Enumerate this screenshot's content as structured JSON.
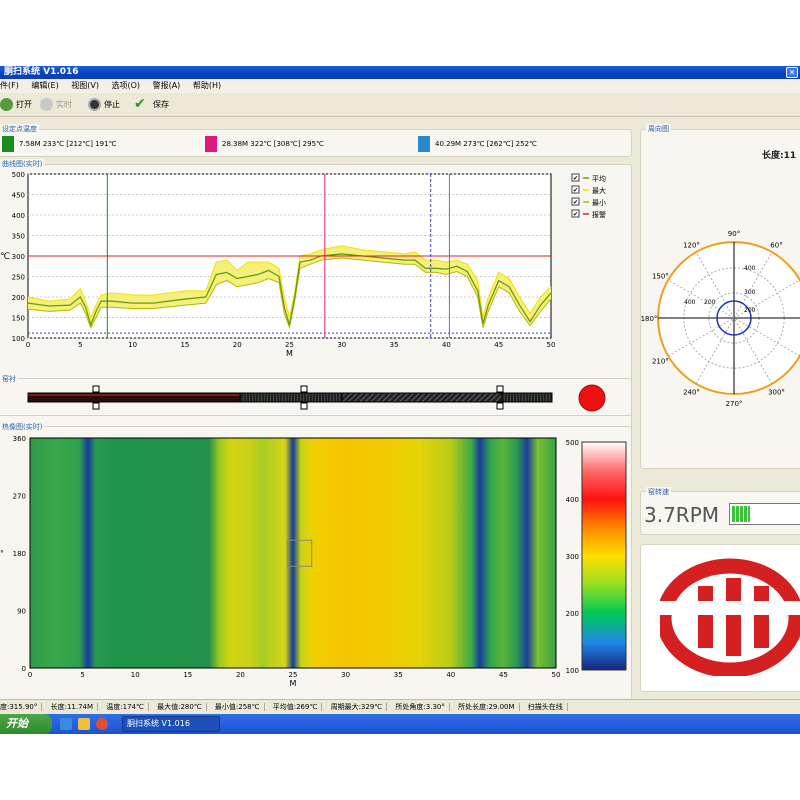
{
  "window": {
    "title": "胴扫系统 V1.016"
  },
  "menu": [
    "件(F)",
    "编辑(E)",
    "视图(V)",
    "选项(O)",
    "警报(A)",
    "帮助(H)"
  ],
  "toolbar": {
    "open": "打开",
    "realtime": "实时",
    "stop": "停止",
    "save": "保存"
  },
  "setpoints": {
    "title": "设定点温度",
    "items": [
      {
        "color": "#1a8a1a",
        "text": "7.58M 233℃ [212℃] 191℃"
      },
      {
        "color": "#e0197a",
        "text": "28.38M 322℃ [308℃] 295℃"
      },
      {
        "color": "#2a8ad0",
        "text": "40.29M 273℃ [262℃] 252℃"
      }
    ]
  },
  "curve": {
    "title": "曲线图(实时)",
    "ylabel": "℃",
    "xlabel": "M",
    "legend": [
      "平均",
      "最大",
      "最小",
      "报警"
    ],
    "alarm_line": 300
  },
  "kiln": {
    "title": "窑衬"
  },
  "thermal": {
    "title": "热像图(实时)",
    "xlabel": "M",
    "ylabel": "°"
  },
  "polar": {
    "title": "周向图",
    "length_label": "长度:11",
    "angle_labels": [
      "90°",
      "60°",
      "120°",
      "150°",
      "180°",
      "210°",
      "240°",
      "270°",
      "300°"
    ],
    "radial_labels": [
      "400",
      "300",
      "200",
      "400",
      "200"
    ]
  },
  "speed": {
    "title": "窑转速",
    "value": "3.7RPM"
  },
  "status": [
    "度:315.90°",
    "长度:11.74M",
    "温度:174℃",
    "最大值:280℃",
    "最小值:258℃",
    "平均值:269℃",
    "周期最大:329℃",
    "所处角度:3.30°",
    "所处长度:29.00M",
    "扫描头在线"
  ],
  "taskbar": {
    "start": "开始",
    "item": "胴扫系统 V1.016"
  },
  "chart_data": [
    {
      "type": "line",
      "title": "曲线图(实时)",
      "xlabel": "M",
      "ylabel": "℃",
      "xlim": [
        0,
        50
      ],
      "ylim": [
        100,
        500
      ],
      "x_ticks": [
        0,
        5,
        10,
        15,
        20,
        25,
        30,
        35,
        40,
        45,
        50
      ],
      "y_ticks": [
        100,
        150,
        200,
        250,
        300,
        350,
        400,
        450,
        500
      ],
      "x": [
        0,
        2,
        4,
        5,
        5.5,
        6,
        6.5,
        7,
        8,
        10,
        12,
        15,
        17,
        18,
        19,
        20,
        21,
        22,
        23,
        24,
        24.5,
        25,
        25.5,
        26,
        27,
        28,
        30,
        32,
        34,
        36,
        37,
        38,
        39,
        40,
        41,
        42,
        43,
        43.5,
        44,
        45,
        46,
        47,
        48,
        49,
        50
      ],
      "series": [
        {
          "name": "最大",
          "color": "#f5e000",
          "values": [
            200,
            190,
            195,
            220,
            190,
            150,
            180,
            205,
            210,
            205,
            205,
            215,
            215,
            285,
            290,
            265,
            285,
            285,
            285,
            270,
            200,
            150,
            210,
            300,
            305,
            315,
            325,
            315,
            310,
            305,
            310,
            290,
            290,
            285,
            290,
            280,
            240,
            150,
            200,
            260,
            245,
            200,
            160,
            200,
            225
          ]
        },
        {
          "name": "平均",
          "color": "#6a9a1a",
          "values": [
            185,
            178,
            180,
            200,
            175,
            132,
            165,
            190,
            190,
            185,
            185,
            195,
            200,
            255,
            260,
            245,
            250,
            255,
            265,
            250,
            175,
            132,
            200,
            285,
            290,
            300,
            305,
            300,
            295,
            290,
            290,
            270,
            270,
            268,
            275,
            262,
            215,
            135,
            180,
            240,
            225,
            180,
            140,
            180,
            210
          ]
        },
        {
          "name": "最小",
          "color": "#b8b800",
          "values": [
            170,
            165,
            168,
            185,
            160,
            125,
            150,
            175,
            175,
            172,
            172,
            180,
            185,
            230,
            240,
            225,
            230,
            235,
            245,
            235,
            160,
            125,
            190,
            270,
            280,
            290,
            295,
            290,
            285,
            280,
            280,
            260,
            260,
            255,
            262,
            250,
            200,
            125,
            165,
            225,
            210,
            165,
            130,
            165,
            195
          ]
        },
        {
          "name": "报警",
          "color": "#e02020",
          "values": [
            300,
            300
          ]
        }
      ],
      "markers": [
        7.58,
        28.38,
        40.29,
        38.5
      ]
    },
    {
      "type": "heatmap",
      "title": "热像图(实时)",
      "xlabel": "M",
      "xlim": [
        0,
        50
      ],
      "ylim": [
        0,
        360
      ],
      "x_ticks": [
        0,
        5,
        10,
        15,
        20,
        25,
        30,
        35,
        40,
        45,
        50
      ],
      "y_ticks": [
        0,
        90,
        180,
        270,
        360
      ],
      "colorbar_ticks": [
        100,
        200,
        300,
        400,
        500
      ]
    }
  ]
}
